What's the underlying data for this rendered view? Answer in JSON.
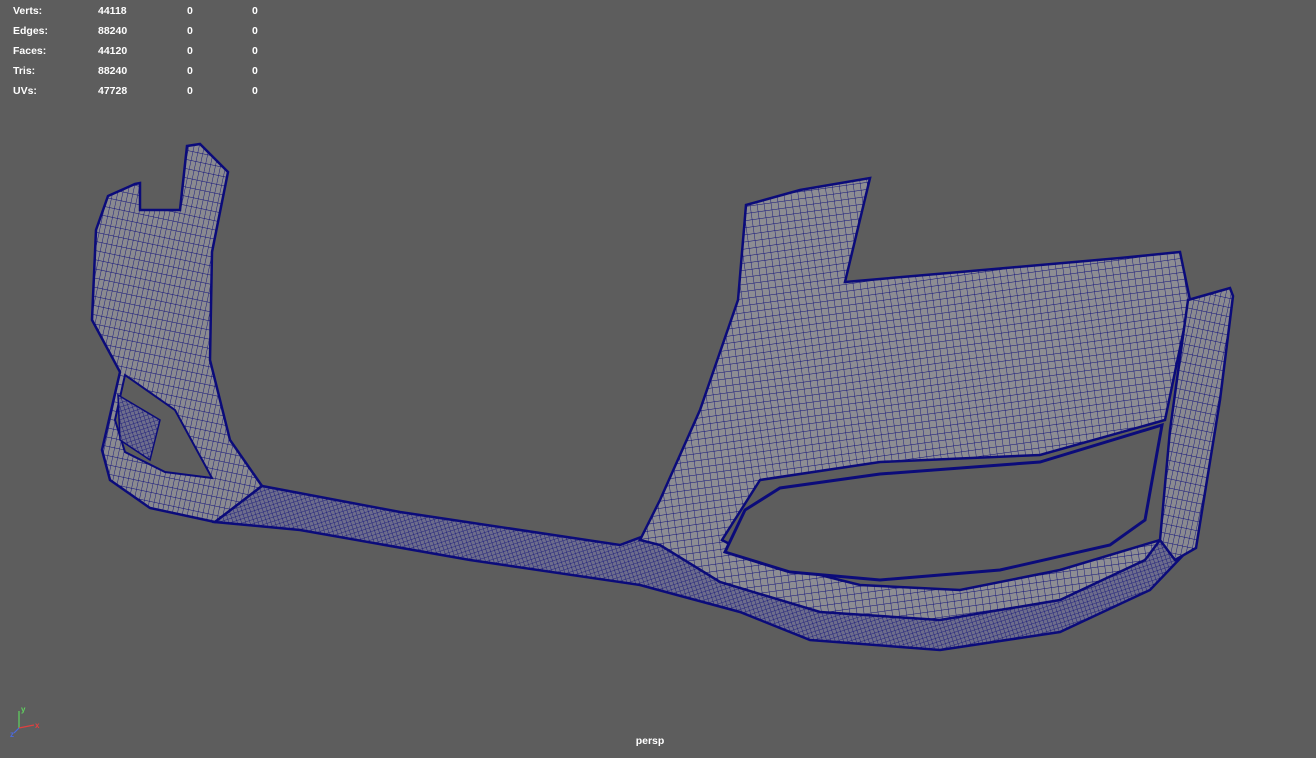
{
  "hud": {
    "rows": [
      {
        "label": "Verts:",
        "values": [
          "44118",
          "0",
          "0"
        ]
      },
      {
        "label": "Edges:",
        "values": [
          "88240",
          "0",
          "0"
        ]
      },
      {
        "label": "Faces:",
        "values": [
          "44120",
          "0",
          "0"
        ]
      },
      {
        "label": "Tris:",
        "values": [
          "88240",
          "0",
          "0"
        ]
      },
      {
        "label": "UVs:",
        "values": [
          "47728",
          "0",
          "0"
        ]
      }
    ]
  },
  "viewport": {
    "camera": "persp",
    "background_color": "#5d5d5d",
    "wire_color": "#0b0b7a",
    "surface_color": "#8c8c8c"
  },
  "axis_gizmo": {
    "x": "x",
    "y": "y",
    "z": "z"
  }
}
